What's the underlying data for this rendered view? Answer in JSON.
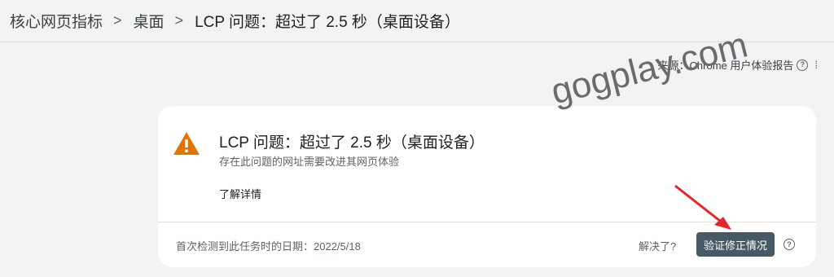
{
  "breadcrumb": {
    "items": [
      "核心网页指标",
      "桌面",
      "LCP 问题：超过了 2.5 秒（桌面设备）"
    ],
    "separator": ">"
  },
  "source": {
    "label": "来源：Chrome 用户体验报告",
    "help_icon": "question-circle"
  },
  "issue": {
    "title": "LCP 问题：超过了 2.5 秒（桌面设备）",
    "subtitle": "存在此问题的网址需要改进其网页体验",
    "learn_more": "了解详情",
    "first_detected": "首次检测到此任务时的日期：2022/5/18",
    "resolved_prompt": "解决了?",
    "validate_button": "验证修正情况",
    "warning_color": "#e37400"
  },
  "watermark": "gogplay.com"
}
